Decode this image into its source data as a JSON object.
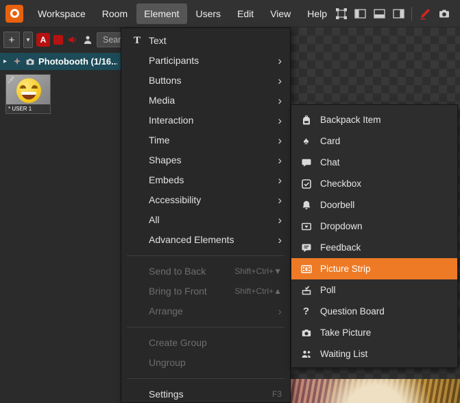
{
  "menubar": {
    "items": [
      {
        "label": "Workspace"
      },
      {
        "label": "Room"
      },
      {
        "label": "Element",
        "active": true
      },
      {
        "label": "Users"
      },
      {
        "label": "Edit"
      },
      {
        "label": "View"
      },
      {
        "label": "Help"
      }
    ]
  },
  "toolbar": {
    "search_placeholder": "Search"
  },
  "layers_panel": {
    "room_label": "Photobooth (1/16...",
    "thumbnail_caption": "* USER 1"
  },
  "element_menu": {
    "items": [
      {
        "label": "Text"
      },
      {
        "label": "Participants",
        "has_submenu": true
      },
      {
        "label": "Buttons",
        "has_submenu": true
      },
      {
        "label": "Media",
        "has_submenu": true
      },
      {
        "label": "Interaction",
        "has_submenu": true,
        "open": true
      },
      {
        "label": "Time",
        "has_submenu": true
      },
      {
        "label": "Shapes",
        "has_submenu": true
      },
      {
        "label": "Embeds",
        "has_submenu": true
      },
      {
        "label": "Accessibility",
        "has_submenu": true
      },
      {
        "label": "All",
        "has_submenu": true
      },
      {
        "label": "Advanced Elements",
        "has_submenu": true
      },
      {
        "label": "Send to Back",
        "shortcut": "Shift+Ctrl+▼",
        "disabled": true
      },
      {
        "label": "Bring to Front",
        "shortcut": "Shift+Ctrl+▲",
        "disabled": true
      },
      {
        "label": "Arrange",
        "has_submenu": true,
        "disabled": true
      },
      {
        "label": "Create Group",
        "disabled": true
      },
      {
        "label": "Ungroup",
        "disabled": true
      },
      {
        "label": "Settings",
        "shortcut": "F3"
      }
    ]
  },
  "interaction_submenu": {
    "items": [
      {
        "label": "Backpack Item"
      },
      {
        "label": "Card"
      },
      {
        "label": "Chat"
      },
      {
        "label": "Checkbox"
      },
      {
        "label": "Doorbell"
      },
      {
        "label": "Dropdown"
      },
      {
        "label": "Feedback"
      },
      {
        "label": "Picture Strip",
        "highlighted": true
      },
      {
        "label": "Poll"
      },
      {
        "label": "Question Board"
      },
      {
        "label": "Take Picture"
      },
      {
        "label": "Waiting List"
      }
    ]
  },
  "glyphs": {
    "text_icon": "T",
    "submenu_arrow": "›",
    "expand_arrow": "▸",
    "caret_down": "▾",
    "plus": "+",
    "letter_a": "A",
    "spade": "♠",
    "question_mark": "?"
  },
  "colors": {
    "accent_orange": "#ee7a25",
    "logo_orange": "#e8610e",
    "selected_row_teal": "#1d4b58",
    "alert_red": "#b61212"
  }
}
